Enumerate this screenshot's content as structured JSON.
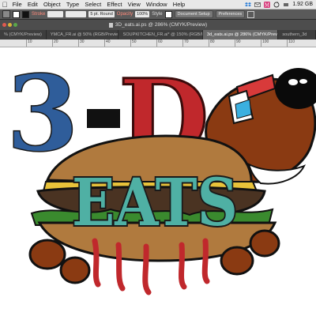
{
  "menubar": {
    "apple": "",
    "items": [
      "File",
      "Edit",
      "Object",
      "Type",
      "Select",
      "Effect",
      "View",
      "Window",
      "Help"
    ],
    "storage": "1.92 GB"
  },
  "control": {
    "stroke_label": "Stroke",
    "brush_value": "5 pt. Round",
    "opacity_label": "Opacity",
    "opacity_value": "100%",
    "style_label": "Style",
    "doc_setup_label": "Document Setup",
    "preferences_label": "Preferences"
  },
  "document": {
    "title": "3D_eats.ai.ps @ 286% (CMYK/Preview)"
  },
  "tabs": [
    {
      "label": "% (CMYK/Preview)",
      "active": false
    },
    {
      "label": "YMCA_FR.ai @ 50% (RGB/Preview)",
      "active": false
    },
    {
      "label": "SOUPKITCHEN_FR.ai* @ 150% (RGB/Preview)",
      "active": false
    },
    {
      "label": "3d_eats.ai.ps @ 286% (CMYK/Preview)",
      "active": true
    },
    {
      "label": "southern_3d",
      "active": false
    }
  ],
  "ruler": {
    "ticks": [
      "10",
      "20",
      "30",
      "40",
      "50",
      "60",
      "70",
      "80",
      "90",
      "100",
      "110"
    ]
  },
  "artwork": {
    "three": "3",
    "dash": "-",
    "d": "D",
    "eats": "EATS"
  },
  "colors": {
    "blue": "#2f5d9a",
    "red": "#c0282c",
    "teal": "#4fb0a4",
    "bun": "#b07a3e",
    "dog": "#8a3a12"
  }
}
